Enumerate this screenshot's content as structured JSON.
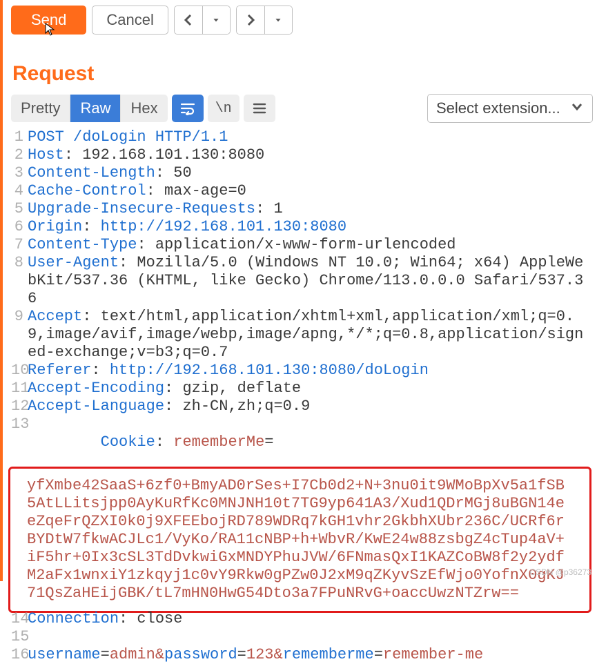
{
  "toolbar": {
    "send_label": "Send",
    "cancel_label": "Cancel"
  },
  "section_title": "Request",
  "view": {
    "tab_pretty": "Pretty",
    "tab_raw": "Raw",
    "tab_hex": "Hex",
    "escapes_label": "\\n",
    "extension_label": "Select extension..."
  },
  "request": {
    "lines": [
      {
        "n": "1",
        "html": "<span class='hn'>POST</span> <span class='hn'>/doLogin</span> <span class='hn'>HTTP/1.1</span>"
      },
      {
        "n": "2",
        "html": "<span class='hn'>Host</span>: 192.168.101.130:8080"
      },
      {
        "n": "3",
        "html": "<span class='hn'>Content-Length</span>: 50"
      },
      {
        "n": "4",
        "html": "<span class='hn'>Cache-Control</span>: max-age=0"
      },
      {
        "n": "5",
        "html": "<span class='hn'>Upgrade-Insecure-Requests</span>: 1"
      },
      {
        "n": "6",
        "html": "<span class='hn'>Origin</span>: <span class='url'>http://192.168.101.130:8080</span>"
      },
      {
        "n": "7",
        "html": "<span class='hn'>Content-Type</span>: application/x-www-form-urlencoded"
      },
      {
        "n": "8",
        "html": "<span class='hn'>User-Agent</span>: Mozilla/5.0 (Windows NT 10.0; Win64; x64) AppleWebKit/537.36 (KHTML, like Gecko) Chrome/113.0.0.0 Safari/537.36"
      },
      {
        "n": "9",
        "html": "<span class='hn'>Accept</span>: text/html,application/xhtml+xml,application/xml;q=0.9,image/avif,image/webp,image/apng,*/*;q=0.8,application/signed-exchange;v=b3;q=0.7"
      },
      {
        "n": "10",
        "html": "<span class='hn'>Referer</span>: <span class='url'>http://192.168.101.130:8080/doLogin</span>"
      },
      {
        "n": "11",
        "html": "<span class='hn'>Accept-Encoding</span>: gzip, deflate"
      },
      {
        "n": "12",
        "html": "<span class='hn'>Accept-Language</span>: zh-CN,zh;q=0.9"
      }
    ],
    "cookie_line_no": "13",
    "cookie_prefix": "Cookie",
    "cookie_name": "rememberMe",
    "cookie_cipher": "yfXmbe42SaaS+6zf0+BmyAD0rSes+I7Cb0d2+N+3nu0it9WMoBpXv5a1fSB5AtLLitsjpp0AyKuRfKc0MNJNH10t7TG9yp641A3/Xud1QDrMGj8uBGN14eeZqeFrQZXI0k0j9XFEEbojRD789WDRq7kGH1vhr2GkbhXUbr236C/UCRf6rBYDtW7fkwACJLc1/VyKo/RA11cNBP+h+WbvR/KwE24w88zsbgZ4cTup4aV+iF5hr+0Ix3cSL3TdDvkwiGxMNDYPhuJVW/6FNmasQxI1KAZCoBW8f2y2ydfM2aFx1wnxiY1zkqyj1c0vY9Rkw0gPZw0J2xM9qZKyvSzEfWjo0YofnX0gKJ71QsZaHEijGBK/tL7mHN0HwG54Dto3a7FPuNRvG+oaccUwzNTZrw==",
    "conn_line_no": "14",
    "conn_html": "<span class='hn'>Connection</span>: close",
    "blank_line_no": "15",
    "body_line_no": "16",
    "body_html": "<span class='pk'>username</span>=<span class='pv'>admin</span><span class='amp'>&amp;</span><span class='pk'>password</span>=<span class='pv'>123</span><span class='amp'>&amp;</span><span class='pk'>rememberme</span>=<span class='pv'>remember-me</span>"
  },
  "watermark": "CSDN @p36273"
}
